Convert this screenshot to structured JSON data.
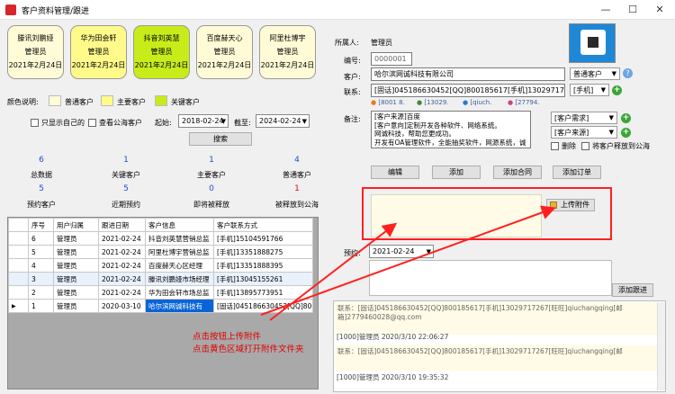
{
  "window": {
    "title": "客户资料管理/跟进",
    "minimize": "—",
    "maximize": "☐",
    "close": "✕"
  },
  "cards": [
    {
      "name": "滕讯刘鹏娅",
      "owner": "管理员",
      "date": "2021年2月24日",
      "color": "#fffbd6"
    },
    {
      "name": "华为田会轩",
      "owner": "管理员",
      "date": "2021年2月24日",
      "color": "#fffa8a"
    },
    {
      "name": "抖音刘英慧",
      "owner": "管理员",
      "date": "2021年2月24日",
      "color": "#c8ec1a"
    },
    {
      "name": "百度赫天心",
      "owner": "管理员",
      "date": "2021年2月24日",
      "color": "#fffbd6"
    },
    {
      "name": "阿里杜博宇",
      "owner": "管理员",
      "date": "2021年2月24日",
      "color": "#fffbd6"
    }
  ],
  "legend": {
    "label": "颜色说明:",
    "normal": "普通客户",
    "major": "主要客户",
    "key": "关键客户",
    "normal_color": "#fffbd6",
    "major_color": "#fffa8a",
    "key_color": "#c8ec1a"
  },
  "filters": {
    "only_mine": "只显示自己的",
    "view_public": "查看公海客户",
    "start_label": "起始:",
    "start": "2018-02-24",
    "end_label": "截至:",
    "end": "2024-02-24",
    "search": "搜索"
  },
  "stats_row1": [
    {
      "num": "6",
      "label": "总数据"
    },
    {
      "num": "1",
      "label": "关键客户"
    },
    {
      "num": "1",
      "label": "主要客户"
    },
    {
      "num": "4",
      "label": "普通客户"
    }
  ],
  "stats_row2": [
    {
      "num": "5",
      "label": "预约客户"
    },
    {
      "num": "5",
      "label": "近期预约"
    },
    {
      "num": "0",
      "label": "即将被释放"
    },
    {
      "num": "1",
      "label": "被释放到公海"
    }
  ],
  "table": {
    "headers": [
      "序号",
      "用户归属",
      "跟进日期",
      "客户信息",
      "客户联系方式"
    ],
    "rows": [
      [
        "6",
        "管理员",
        "2021-02-24",
        "抖音刘英慧营销总监",
        "[手机]15104591766"
      ],
      [
        "5",
        "管理员",
        "2021-02-24",
        "阿里杜博宇营销总监",
        "[手机]13351888275"
      ],
      [
        "4",
        "管理员",
        "2021-02-24",
        "百度赫天心区经理",
        "[手机]13351888395"
      ],
      [
        "3",
        "管理员",
        "2021-02-24",
        "滕讯刘鹏娅市场经理",
        "[手机]13045155261"
      ],
      [
        "2",
        "管理员",
        "2021-02-24",
        "华为田会轩市场总监",
        "[手机]13895773951"
      ],
      [
        "1",
        "管理员",
        "2020-03-10",
        "哈尔滨网诚科技有",
        "[固话]045186630452[QQ]8001856"
      ]
    ]
  },
  "form": {
    "owner_label": "所属人:",
    "owner": "管理员",
    "code_label": "编号:",
    "code": "0000001",
    "customer_label": "客户:",
    "customer": "哈尔滨网诚科技有限公司",
    "customer_type": "普通客户",
    "help": "?",
    "contact_label": "联系:",
    "contact": "[固话]045186630452[QQ]800185617[手机]13029717267[旺旺]qi",
    "contact_type": "[手机]",
    "chips": [
      "[8001 8.",
      "[13029.",
      "[qiuch.",
      "[27794."
    ],
    "remark_label": "备注:",
    "remark": "[客户来源]百度\n[客户意向]定制开发各种软件、网络系统。\n网诚科技，帮助您更成功。\n开发有OA管理软件，全能抽奖软件，网源系统，诚信首科。",
    "need": "[客户需求]",
    "source": "[客户来源]",
    "delete": "删除",
    "release": "将客户释放到公海",
    "btn_edit": "编辑",
    "btn_add": "添加",
    "btn_contract": "添加合同",
    "btn_order": "添加订单",
    "btn_upload": "上传附件",
    "appoint_label": "预约:",
    "appoint": "2021-02-24",
    "btn_follow": "添加跟进"
  },
  "logs": [
    {
      "text": "联系：[固话]045186630452[QQ]800185617[手机]13029717267[旺旺]qiuchangqing[邮箱]2779460028@qq.com",
      "meta": "[1000]管理员  2020/3/10 22:06:27"
    },
    {
      "text": "联系：[固话]045186630452[QQ]800185617[手机]13029717267[旺旺]qiuchangqing[邮",
      "meta": "[1000]管理员  2020/3/10 19:35:32"
    }
  ],
  "annotation": {
    "line1": "点击按钮上传附件",
    "line2": "点击黄色区域打开附件文件夹"
  }
}
